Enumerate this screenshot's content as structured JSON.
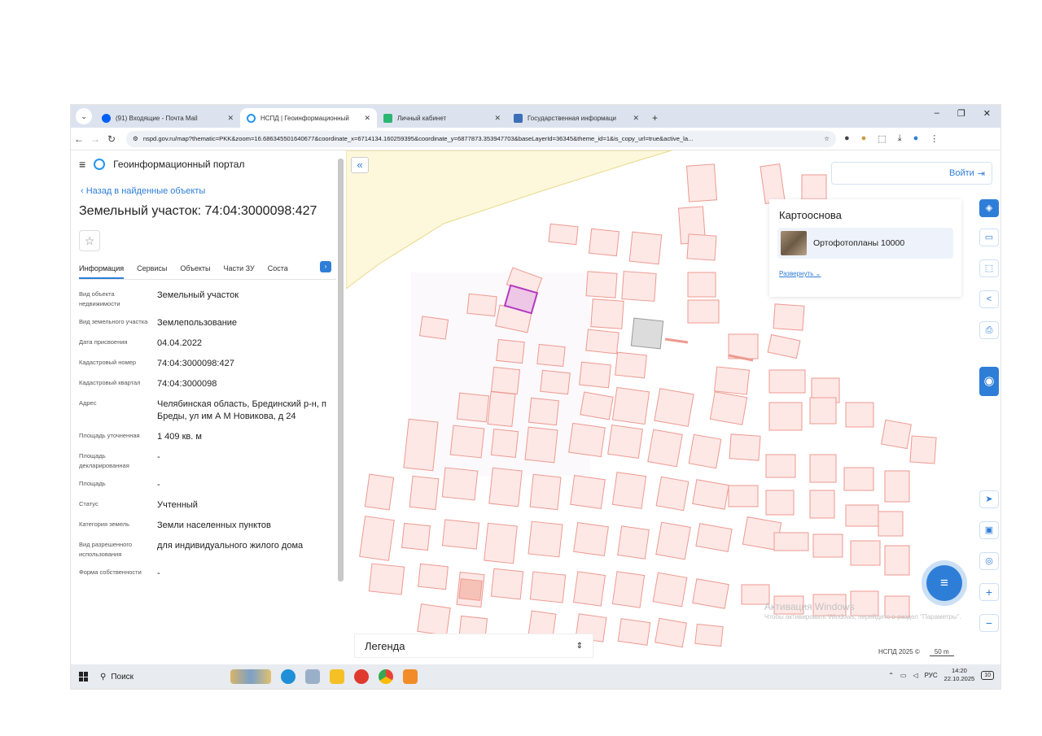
{
  "browser": {
    "tabs": [
      {
        "title": "(91) Входящие - Почта Mail",
        "icon_color": "#005ff9"
      },
      {
        "title": "НСПД | Геоинформационный",
        "icon_color": "#2196f3"
      },
      {
        "title": "Личный кабинет",
        "icon_color": "#2bb673"
      },
      {
        "title": "Государственная информаци",
        "icon_color": "#3d6fb8"
      }
    ],
    "new_tab": "+",
    "url": "nspd.gov.ru/map?thematic=PKK&zoom=16.686345501640677&coordinate_x=6714134.160259395&coordinate_y=6877873.353947703&baseLayerId=36345&theme_id=1&is_copy_url=true&active_la...",
    "window_controls": [
      "–",
      "❐",
      "✕"
    ]
  },
  "sidebar": {
    "portal_title": "Геоинформационный портал",
    "back_link": "Назад в найденные объекты",
    "object_title": "Земельный участок: 74:04:3000098:427",
    "tabs": [
      "Информация",
      "Сервисы",
      "Объекты",
      "Части ЗУ",
      "Соста"
    ],
    "properties": [
      {
        "key": "Вид объекта недвижимости",
        "value": "Земельный участок"
      },
      {
        "key": "Вид земельного участка",
        "value": "Землепользование"
      },
      {
        "key": "Дата присвоения",
        "value": "04.04.2022"
      },
      {
        "key": "Кадастровый номер",
        "value": "74:04:3000098:427"
      },
      {
        "key": "Кадастровый квартал",
        "value": "74:04:3000098"
      },
      {
        "key": "Адрес",
        "value": "Челябинская область, Брединский р-н, п Бреды, ул им А М Новикова, д 24"
      },
      {
        "key": "Площадь уточненная",
        "value": "1 409 кв. м"
      },
      {
        "key": "Площадь декларированная",
        "value": "-"
      },
      {
        "key": "Площадь",
        "value": "-"
      },
      {
        "key": "Статус",
        "value": "Учтенный"
      },
      {
        "key": "Категория земель",
        "value": "Земли населенных пунктов"
      },
      {
        "key": "Вид разрешенного использования",
        "value": "для индивидуального жилого дома"
      },
      {
        "key": "Форма собственности",
        "value": "-"
      }
    ]
  },
  "map": {
    "login_label": "Войти",
    "basemap_title": "Картооснова",
    "basemap_option": "Ортофотопланы 10000",
    "expand_link": "Развернуть",
    "legend_label": "Легенда",
    "watermark_title": "Активация Windows",
    "watermark_text": "Чтобы активировать Windows, перейдите в раздел \"Параметры\".",
    "attribution": "НСПД 2025 ©",
    "scale_label": "50 m",
    "colors": {
      "parcel_fill": "#fde8e6",
      "parcel_stroke": "#ee9a90",
      "selected": "#b23ac2",
      "accent": "#2e7ed8",
      "zone": "#fdf7dc"
    }
  },
  "taskbar": {
    "search_label": "Поиск",
    "lang": "РУС",
    "time": "14:20",
    "date": "22.10.2025",
    "notifications": "10"
  }
}
